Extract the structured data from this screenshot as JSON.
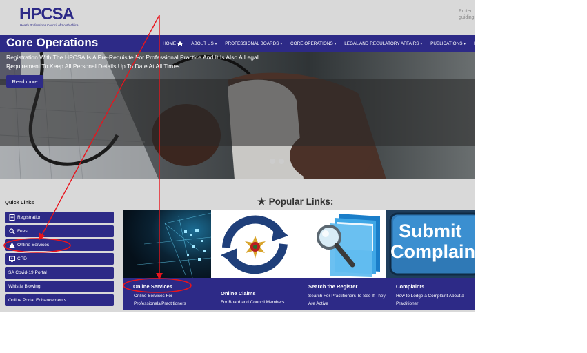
{
  "header": {
    "logo_text": "HPCSA",
    "logo_subtitle": "Health Professions Council of South Africa",
    "tagline_line1": "Protec",
    "tagline_line2": "guiding"
  },
  "nav": {
    "items": [
      {
        "label": "HOME",
        "icon": "home-icon"
      },
      {
        "label": "ABOUT US",
        "icon": "chevron-down-icon"
      },
      {
        "label": "PROFESSIONAL BOARDS",
        "icon": "chevron-down-icon"
      },
      {
        "label": "CORE OPERATIONS",
        "icon": "chevron-down-icon"
      },
      {
        "label": "LEGAL AND REGULATORY AFFAIRS",
        "icon": "chevron-down-icon"
      },
      {
        "label": "PUBLICATIONS",
        "icon": "chevron-down-icon"
      },
      {
        "label": "E",
        "icon": ""
      }
    ]
  },
  "hero": {
    "prev_symbol": "<",
    "title": "Core Operations",
    "description": "Registration With The HPCSA Is A Pre-Requisite For Professional Practice And It Is Also A Legal Requirement To Keep All Personal Details Up To Date At All Times.",
    "button_label": "Read more"
  },
  "quick_links": {
    "title": "Quick Links",
    "items": [
      {
        "label": "Registration",
        "icon": "document-icon"
      },
      {
        "label": "Fees",
        "icon": "search-icon"
      },
      {
        "label": "Online Services",
        "icon": "warning-icon"
      },
      {
        "label": "CPD",
        "icon": "monitor-icon"
      },
      {
        "label": "SA Covid-19 Portal",
        "icon": ""
      },
      {
        "label": "Whistle Blowing",
        "icon": ""
      },
      {
        "label": "Online Portal Enhancements",
        "icon": ""
      }
    ]
  },
  "popular": {
    "title": "Popular Links:",
    "cards": [
      {
        "title": "Online Services",
        "description": "Online Services For Professionals/Practitioners",
        "image": "digital-network-image"
      },
      {
        "title": "Online Claims",
        "description": "For Board and Council Members .",
        "image": "refresh-coat-of-arms-image"
      },
      {
        "title": "Search the Register",
        "description": "Search For Practitioners To See If They Are Active",
        "image": "folder-magnifier-image"
      },
      {
        "title": "Complaints",
        "description": "How to Lodge a Complaint About a Practitioner",
        "image": "submit-complaint-key-image",
        "image_text_1": "Submit",
        "image_text_2": "Complain"
      }
    ]
  },
  "colors": {
    "brand": "#2d2a87",
    "page_bg": "#d9d9d9",
    "annotation": "#e8141c"
  }
}
